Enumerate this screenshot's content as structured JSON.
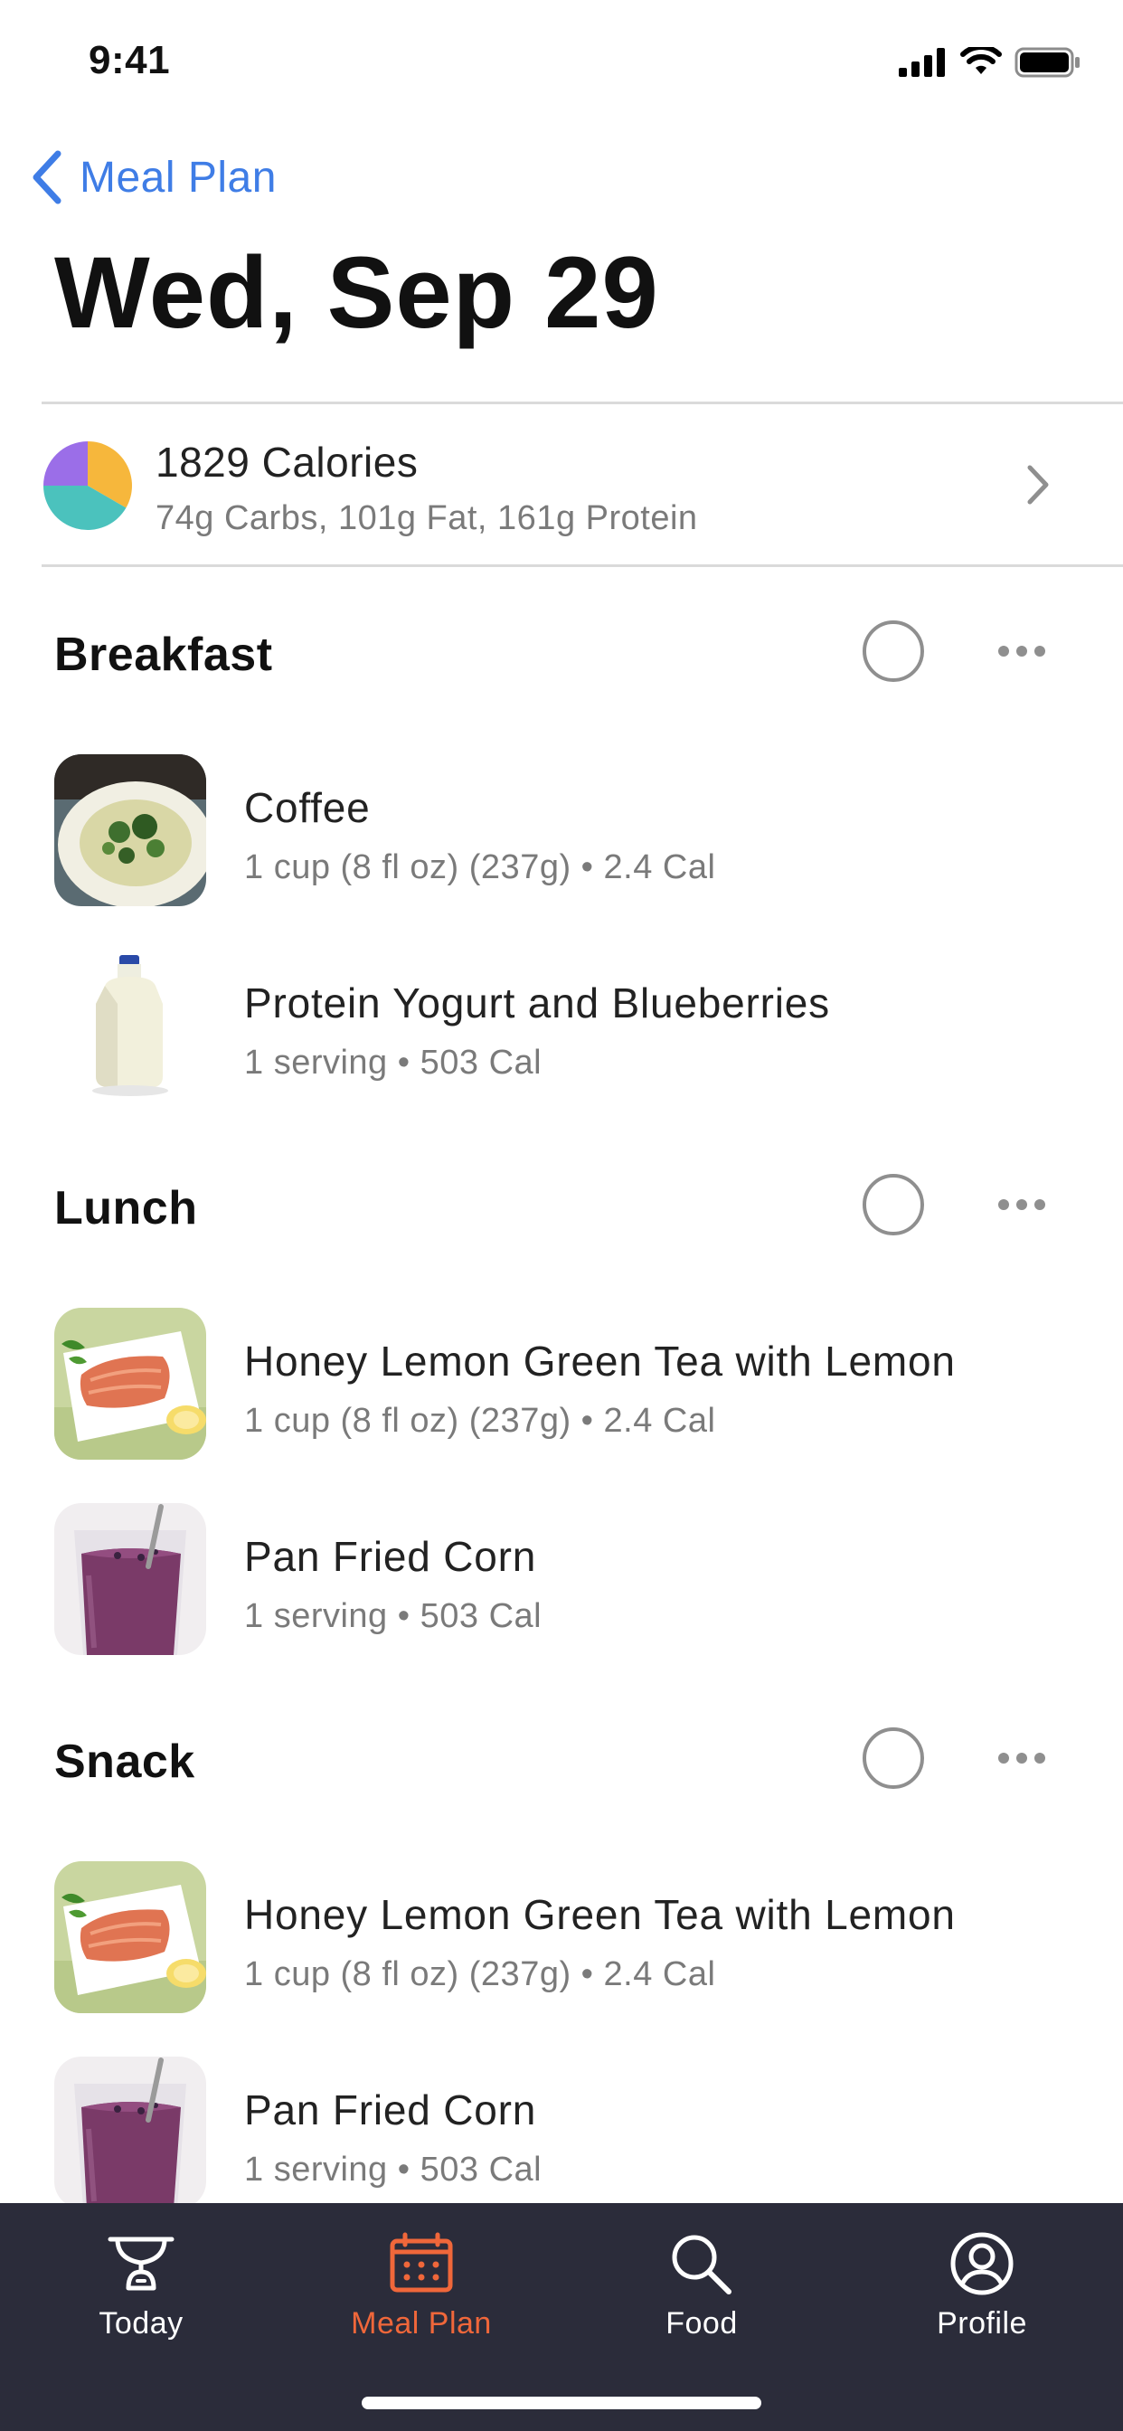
{
  "status_bar": {
    "time": "9:41"
  },
  "nav": {
    "back_label": "Meal Plan"
  },
  "page": {
    "title": "Wed, Sep 29"
  },
  "summary": {
    "calories": "1829 Calories",
    "macros": "74g Carbs, 101g Fat, 161g Protein"
  },
  "sections": [
    {
      "title": "Breakfast",
      "items": [
        {
          "name": "Coffee",
          "detail": "1 cup (8 fl oz) (237g) • 2.4 Cal",
          "image": "pasta-bowl-photo"
        },
        {
          "name": "Protein Yogurt and Blueberries",
          "detail": "1 serving • 503 Cal",
          "image": "milk-jug-photo"
        }
      ]
    },
    {
      "title": "Lunch",
      "items": [
        {
          "name": "Honey Lemon Green Tea with Lemon",
          "detail": "1 cup (8 fl oz) (237g) • 2.4 Cal",
          "image": "salmon-plate-photo"
        },
        {
          "name": "Pan Fried Corn",
          "detail": "1 serving • 503 Cal",
          "image": "berry-smoothie-photo"
        }
      ]
    },
    {
      "title": "Snack",
      "items": [
        {
          "name": "Honey Lemon Green Tea with Lemon",
          "detail": "1 cup (8 fl oz) (237g) • 2.4 Cal",
          "image": "salmon-plate-photo"
        },
        {
          "name": "Pan Fried Corn",
          "detail": "1 serving • 503 Cal",
          "image": "berry-smoothie-photo"
        }
      ]
    }
  ],
  "tabbar": {
    "tabs": [
      {
        "label": "Today",
        "icon": "scale-icon",
        "active": false
      },
      {
        "label": "Meal Plan",
        "icon": "calendar-icon",
        "active": true
      },
      {
        "label": "Food",
        "icon": "search-icon",
        "active": false
      },
      {
        "label": "Profile",
        "icon": "profile-icon",
        "active": false
      }
    ]
  },
  "colors": {
    "accent_blue": "#3f7de6",
    "tab_active": "#f0673a",
    "tabbar_bg": "#2b2c3a",
    "pie_carbs": "#f6b73c",
    "pie_fat": "#9b6ee8",
    "pie_protein": "#4bc2bd"
  }
}
